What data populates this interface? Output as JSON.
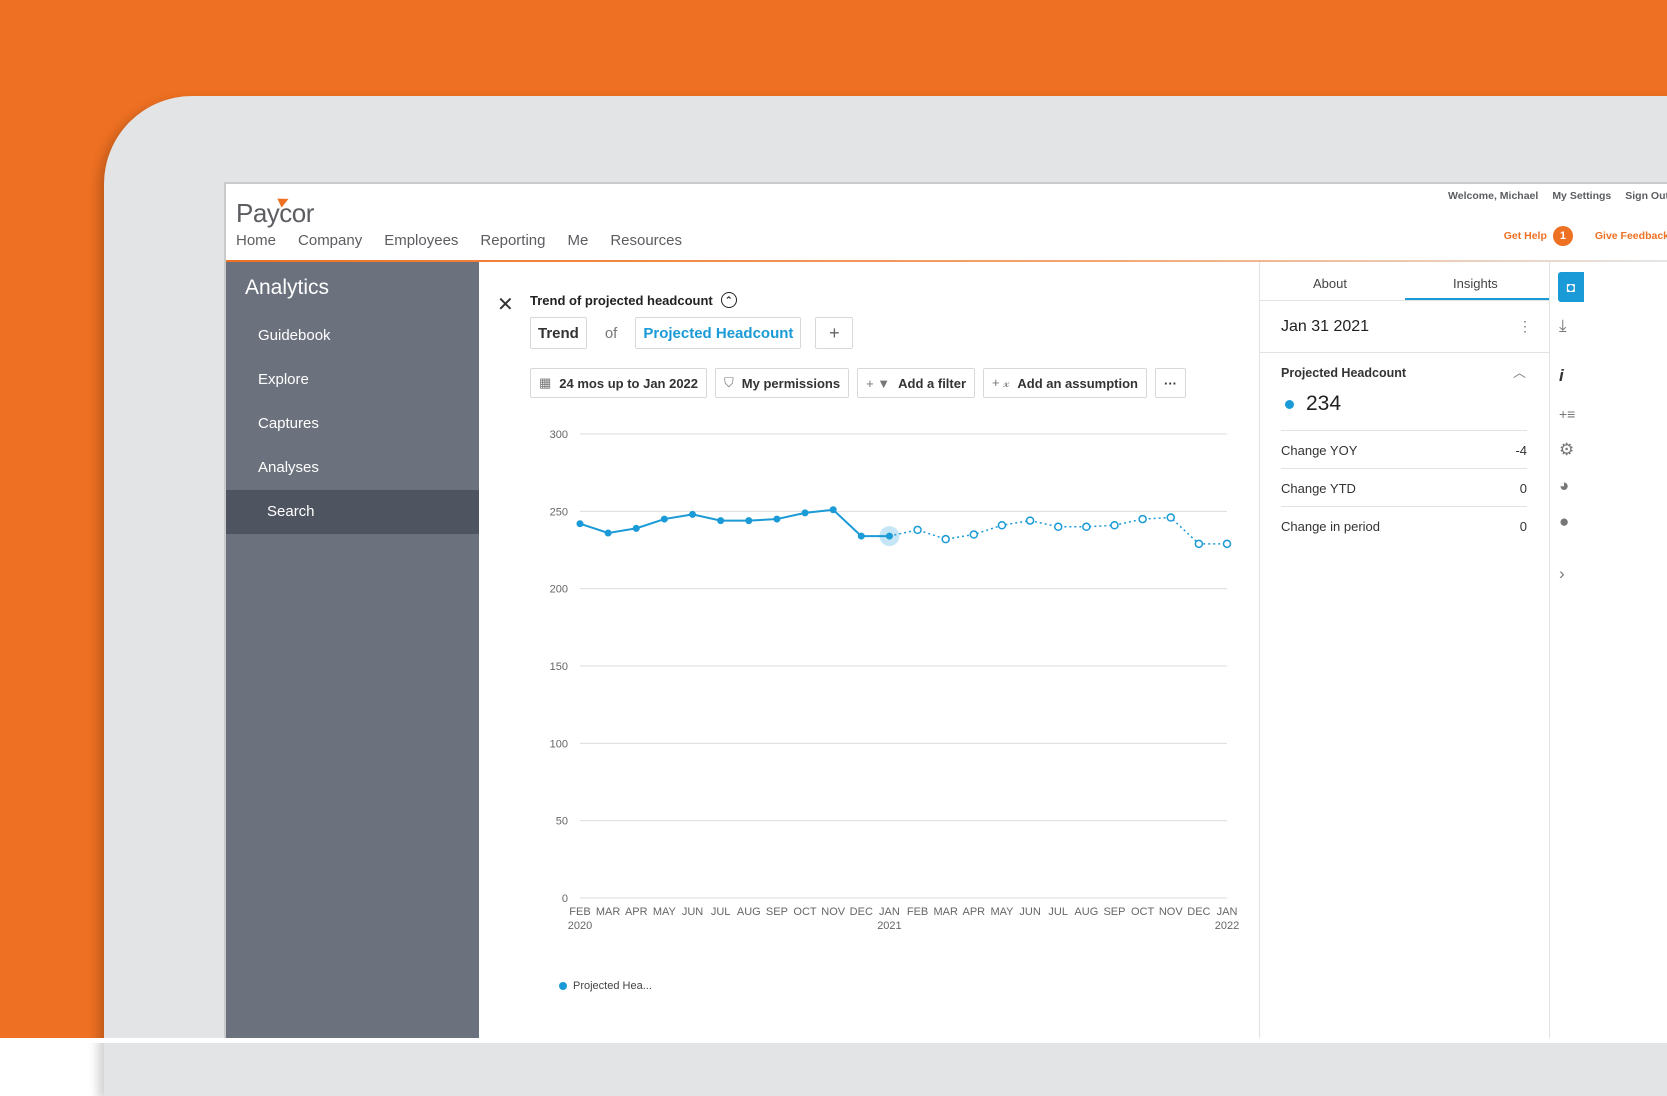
{
  "header": {
    "logo": "Paycor",
    "nav": [
      "Home",
      "Company",
      "Employees",
      "Reporting",
      "Me",
      "Resources"
    ],
    "welcome": "Welcome, Michael",
    "my_settings": "My Settings",
    "sign_out": "Sign Out",
    "get_help": "Get Help",
    "help_count": "1",
    "give_feedback": "Give Feedback"
  },
  "sidebar": {
    "title": "Analytics",
    "items": [
      "Guidebook",
      "Explore",
      "Captures",
      "Analyses",
      "Search"
    ],
    "active": "Search"
  },
  "query": {
    "chart_title": "Trend of projected headcount",
    "trend": "Trend",
    "of": "of",
    "measure": "Projected Headcount",
    "add": "+"
  },
  "filters": {
    "range": "24 mos up to Jan 2022",
    "permissions": "My permissions",
    "add_filter": "Add a filter",
    "add_assumption": "Add an assumption",
    "more": "···"
  },
  "chart_data": {
    "type": "line",
    "title": "Trend of projected headcount",
    "x": [
      "FEB 2020",
      "MAR",
      "APR",
      "MAY",
      "JUN",
      "JUL",
      "AUG",
      "SEP",
      "OCT",
      "NOV",
      "DEC",
      "JAN 2021",
      "FEB",
      "MAR",
      "APR",
      "MAY",
      "JUN",
      "JUL",
      "AUG",
      "SEP",
      "OCT",
      "NOV",
      "DEC",
      "JAN 2022"
    ],
    "x_tick_top": [
      "FEB",
      "MAR",
      "APR",
      "MAY",
      "JUN",
      "JUL",
      "AUG",
      "SEP",
      "OCT",
      "NOV",
      "DEC",
      "JAN",
      "FEB",
      "MAR",
      "APR",
      "MAY",
      "JUN",
      "JUL",
      "AUG",
      "SEP",
      "OCT",
      "NOV",
      "DEC",
      "JAN"
    ],
    "x_tick_bottom": {
      "0": "2020",
      "11": "2021",
      "23": "2022"
    },
    "series": [
      {
        "name": "Projected Hea...",
        "values": [
          242,
          236,
          239,
          245,
          248,
          244,
          244,
          245,
          249,
          251,
          234,
          234,
          238,
          232,
          235,
          241,
          244,
          240,
          240,
          241,
          245,
          246,
          229,
          229
        ],
        "actual_through_index": 11,
        "color": "#1a9ad6"
      }
    ],
    "highlight_index": 11,
    "ylim": [
      0,
      300
    ],
    "yticks": [
      0,
      50,
      100,
      150,
      200,
      250,
      300
    ],
    "grid": true,
    "legend": "bottom-left"
  },
  "insights": {
    "tabs": [
      "About",
      "Insights"
    ],
    "active_tab": "Insights",
    "date": "Jan 31 2021",
    "metric": "Projected Headcount",
    "value": "234",
    "rows": [
      {
        "label": "Change YOY",
        "value": "-4"
      },
      {
        "label": "Change YTD",
        "value": "0"
      },
      {
        "label": "Change in period",
        "value": "0"
      }
    ]
  },
  "strip_icons": [
    "capture-icon",
    "download-icon",
    "info-icon",
    "add-list-icon",
    "gear-icon",
    "palette-icon",
    "alert-icon",
    "chevron-right-icon"
  ]
}
